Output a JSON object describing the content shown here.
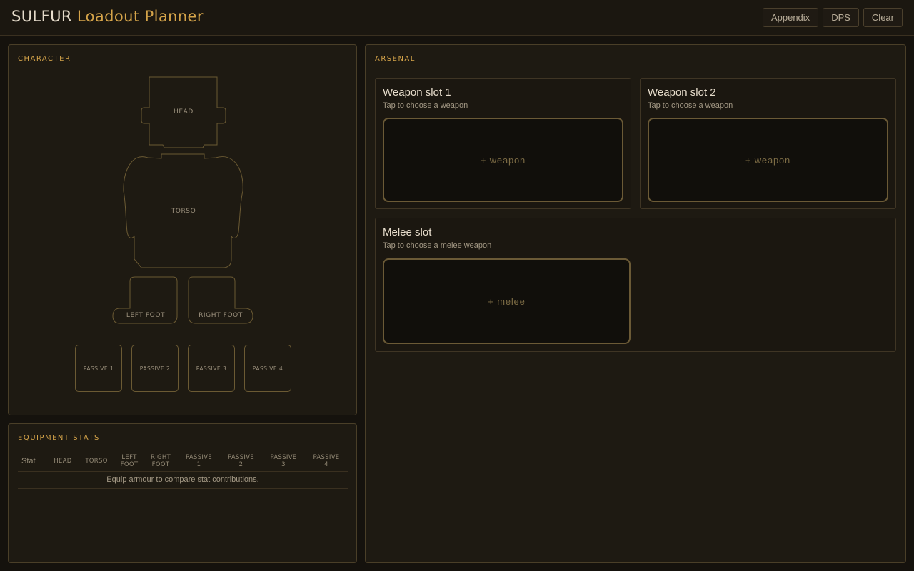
{
  "header": {
    "brand": "SULFUR",
    "subtitle": "Loadout Planner",
    "buttons": {
      "appendix": "Appendix",
      "dps": "DPS",
      "clear": "Clear"
    }
  },
  "character": {
    "title": "CHARACTER",
    "slots": {
      "head": "HEAD",
      "torso": "TORSO",
      "left_foot": "LEFT FOOT",
      "right_foot": "RIGHT FOOT"
    },
    "passives": [
      "PASSIVE 1",
      "PASSIVE 2",
      "PASSIVE 3",
      "PASSIVE 4"
    ]
  },
  "stats": {
    "title": "EQUIPMENT STATS",
    "columns": {
      "stat": "Stat",
      "head": "HEAD",
      "torso": "TORSO",
      "left_foot": [
        "LEFT",
        "FOOT"
      ],
      "right_foot": [
        "RIGHT",
        "FOOT"
      ],
      "passive1": [
        "PASSIVE",
        "1"
      ],
      "passive2": [
        "PASSIVE",
        "2"
      ],
      "passive3": [
        "PASSIVE",
        "3"
      ],
      "passive4": [
        "PASSIVE",
        "4"
      ]
    },
    "empty_message": "Equip armour to compare stat contributions."
  },
  "arsenal": {
    "title": "ARSENAL",
    "weapon1": {
      "title": "Weapon slot 1",
      "subtitle": "Tap to choose a weapon",
      "drop_label": "+ weapon"
    },
    "weapon2": {
      "title": "Weapon slot 2",
      "subtitle": "Tap to choose a weapon",
      "drop_label": "+ weapon"
    },
    "melee": {
      "title": "Melee slot",
      "subtitle": "Tap to choose a melee weapon",
      "drop_label": "+ melee"
    }
  },
  "colors": {
    "background": "#15120d",
    "panel": "#1e1a12",
    "accent": "#d5a44a",
    "outline": "#6b5a33"
  }
}
